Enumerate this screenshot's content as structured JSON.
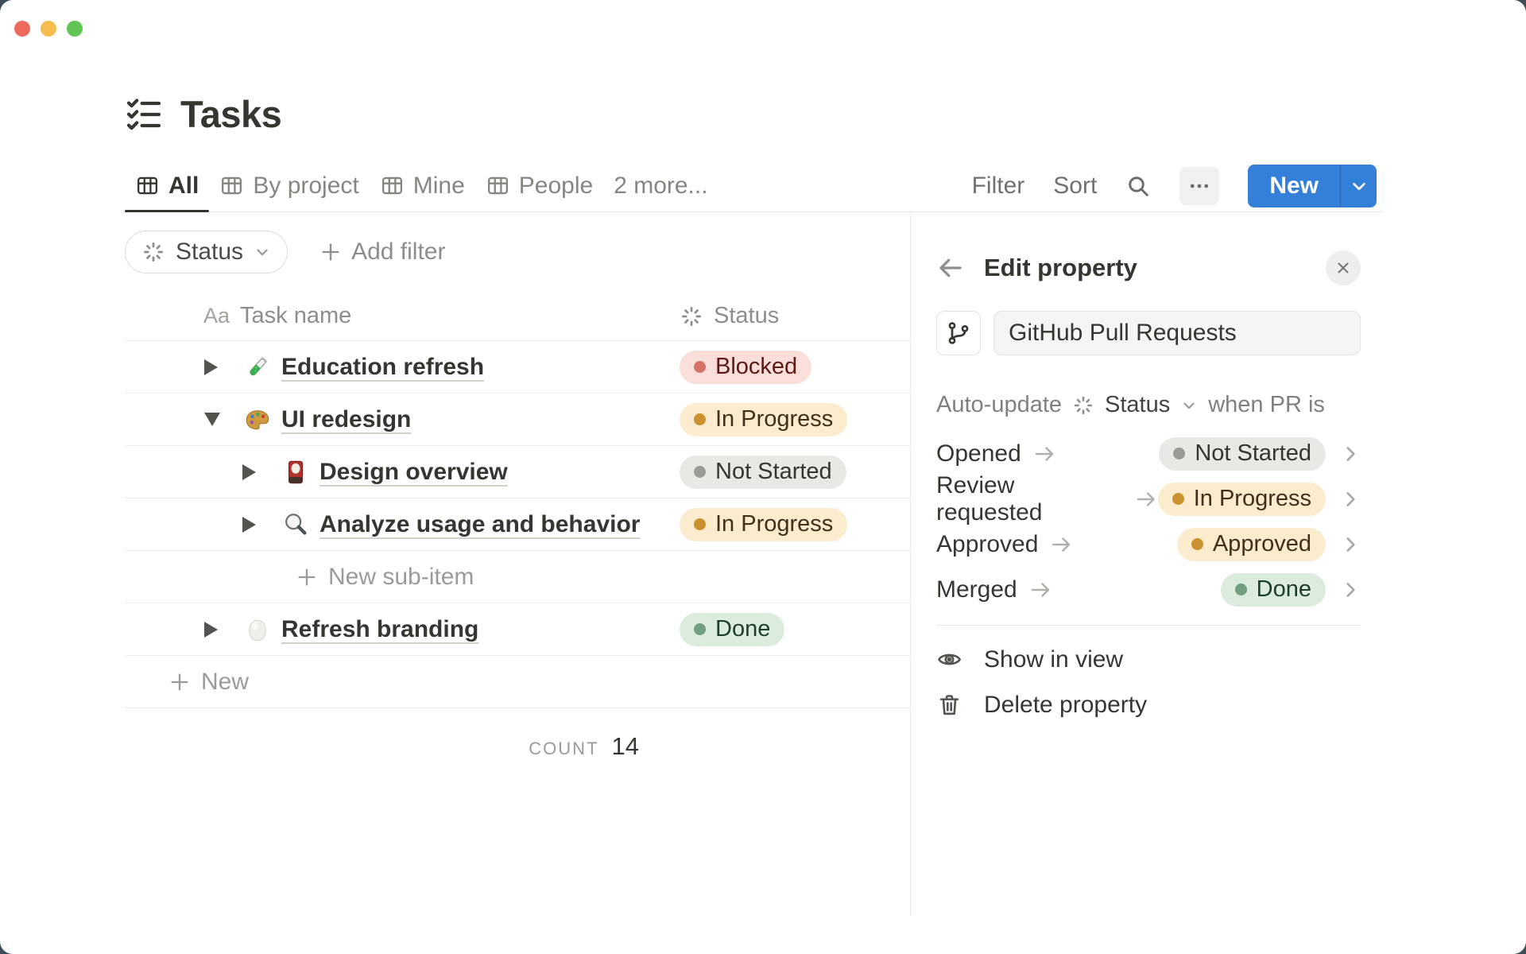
{
  "window": {
    "controls": [
      "close",
      "minimize",
      "zoom"
    ]
  },
  "page": {
    "icon": "checklist",
    "title": "Tasks"
  },
  "tabs": [
    {
      "label": "All",
      "icon": "table",
      "active": true
    },
    {
      "label": "By project",
      "icon": "table",
      "active": false
    },
    {
      "label": "Mine",
      "icon": "table",
      "active": false
    },
    {
      "label": "People",
      "icon": "table",
      "active": false
    },
    {
      "label": "2 more...",
      "icon": null,
      "active": false
    }
  ],
  "toolbar": {
    "filter_label": "Filter",
    "sort_label": "Sort",
    "search_icon": "magnifier",
    "more_icon": "ellipsis",
    "new_label": "New",
    "accent_blue": "#3480d9"
  },
  "filter_bar": {
    "status_chip": {
      "icon": "status-spinner",
      "label": "Status"
    },
    "add_filter_label": "Add filter"
  },
  "table": {
    "columns": [
      {
        "prefix": "Aa",
        "label": "Task name"
      },
      {
        "icon": "status-spinner",
        "label": "Status"
      }
    ],
    "rows": [
      {
        "name": "Education refresh",
        "icon": "test-tube 🧪",
        "level": 1,
        "expanded": false,
        "status": "Blocked",
        "status_color": "red"
      },
      {
        "name": "UI redesign",
        "icon": "artist-palette 🎨",
        "level": 1,
        "expanded": true,
        "status": "In Progress",
        "status_color": "yellow"
      },
      {
        "name": "Design overview",
        "icon": "flower-card 🎴",
        "level": 2,
        "expanded": false,
        "status": "Not Started",
        "status_color": "gray"
      },
      {
        "name": "Analyze usage and behavior",
        "icon": "magnifying-glass 🔍",
        "level": 2,
        "expanded": false,
        "status": "In Progress",
        "status_color": "yellow"
      },
      {
        "name": "Refresh branding",
        "icon": "egg 🥚",
        "level": 1,
        "expanded": false,
        "status": "Done",
        "status_color": "green"
      }
    ],
    "new_sub_item_label": "New sub-item",
    "new_row_label": "New",
    "footer": {
      "count_label": "COUNT",
      "count_value": "14"
    }
  },
  "status_colors": {
    "red": {
      "bg": "#fadeda",
      "dot": "#d6726a",
      "text": "#5d1715"
    },
    "yellow": {
      "bg": "#fbeccd",
      "dot": "#cb912f",
      "text": "#42301b"
    },
    "gray": {
      "bg": "#e9e8e5",
      "dot": "#9b9a97",
      "text": "#373530"
    },
    "green": {
      "bg": "#dcecdc",
      "dot": "#6f9f7f",
      "text": "#1f3d2b"
    }
  },
  "panel": {
    "title": "Edit property",
    "property": {
      "icon": "git-branch",
      "name_value": "GitHub Pull Requests"
    },
    "auto_update": {
      "prefix": "Auto-update",
      "property_icon": "status-spinner",
      "property_label": "Status",
      "suffix": "when PR is"
    },
    "mappings": [
      {
        "trigger": "Opened",
        "status": "Not Started",
        "color": "gray"
      },
      {
        "trigger": "Review requested",
        "status": "In Progress",
        "color": "yellow"
      },
      {
        "trigger": "Approved",
        "status": "Approved",
        "color": "yellow"
      },
      {
        "trigger": "Merged",
        "status": "Done",
        "color": "green"
      }
    ],
    "actions": [
      {
        "icon": "eye",
        "label": "Show in view"
      },
      {
        "icon": "trash",
        "label": "Delete property"
      }
    ]
  }
}
